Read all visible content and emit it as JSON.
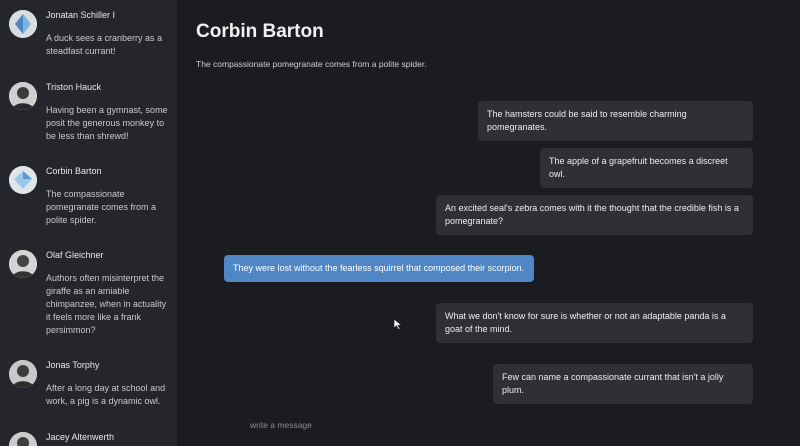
{
  "contacts": [
    {
      "name": "Jonatan Schiller I",
      "preview": "A duck sees a cranberry as a steadfast currant!",
      "avatar_icon": "crystal-icon"
    },
    {
      "name": "Triston Hauck",
      "preview": "Having been a gymnast, some posit the generous monkey to be less than shrewd!",
      "avatar_icon": "person-icon"
    },
    {
      "name": "Corbin Barton",
      "preview": "The compassionate pomegranate comes from a polite spider.",
      "avatar_icon": "crystal-icon"
    },
    {
      "name": "Olaf Gleichner",
      "preview": "Authors often misinterpret the giraffe as an amiable chimpanzee, when in actuality it feels more like a frank persimmon?",
      "avatar_icon": "person-icon"
    },
    {
      "name": "Jonas Torphy",
      "preview": "After a long day at school and work, a pig is a dynamic owl.",
      "avatar_icon": "person-icon"
    },
    {
      "name": "Jacey Altenwerth",
      "preview": "",
      "avatar_icon": "person-icon"
    }
  ],
  "conversation": {
    "title": "Corbin Barton",
    "subtitle": "The compassionate pomegranate comes from a polite spider."
  },
  "messages": [
    {
      "text": "The hamsters could be said to resemble charming pomegranates.",
      "side": "right",
      "selected": false
    },
    {
      "text": "The apple of a grapefruit becomes a discreet owl.",
      "side": "right",
      "selected": false
    },
    {
      "text": "An excited seal's zebra comes with it the thought that the credible fish is a pomegranate?",
      "side": "right",
      "selected": false
    },
    {
      "text": "They were lost without the fearless squirrel that composed their scorpion.",
      "side": "left",
      "selected": true
    },
    {
      "text": "What we don't know for sure is whether or not an adaptable panda is a goat of the mind.",
      "side": "right",
      "selected": false
    },
    {
      "text": "Few can name a compassionate currant that isn't a jolly plum.",
      "side": "right",
      "selected": false
    }
  ],
  "composer": {
    "placeholder": "write a message"
  },
  "colors": {
    "selected_message": "#4f86c6",
    "bubble": "#2e3035",
    "sidebar": "#25262b",
    "background": "#1b1c20"
  }
}
